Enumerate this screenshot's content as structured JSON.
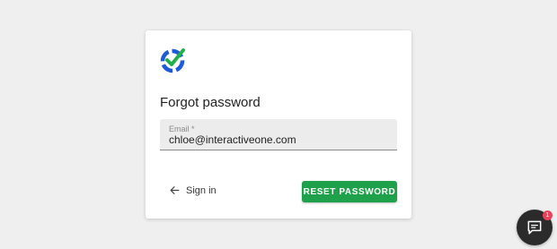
{
  "colors": {
    "page_background": "#efefef",
    "card_background": "#ffffff",
    "primary_button": "#1ea14a",
    "logo_blue": "#1e5bd8",
    "logo_green": "#22b04a",
    "chat_button": "#2b2b2b",
    "badge": "#e8425b"
  },
  "icons": {
    "logo": "brand-checkmark-logo",
    "back": "arrow-left-icon",
    "chat": "chat-bubble-icon"
  },
  "form": {
    "title": "Forgot password",
    "email_label": "Email *",
    "email_value": "chloe@interactiveone.com",
    "sign_in_label": "Sign in",
    "reset_button_label": "RESET PASSWORD"
  },
  "chat_widget": {
    "badge_count": "1"
  }
}
